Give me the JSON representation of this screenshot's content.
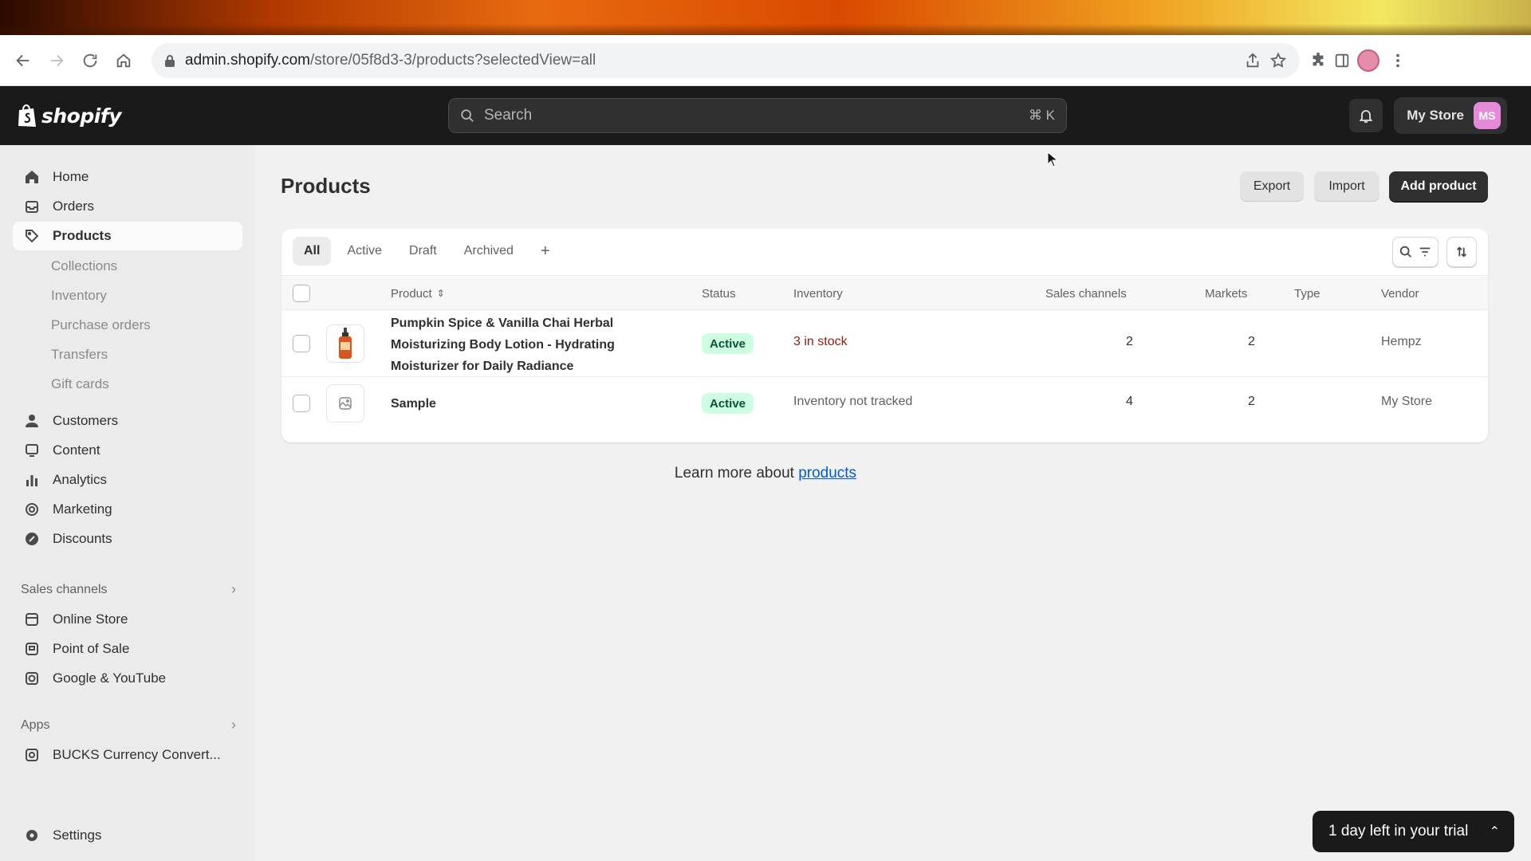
{
  "browser": {
    "url_host": "admin.shopify.com",
    "url_path": "/store/05f8d3-3/products?selectedView=all"
  },
  "topbar": {
    "logo_text": "shopify",
    "search_placeholder": "Search",
    "search_shortcut": "⌘ K",
    "store_name": "My Store",
    "store_initials": "MS"
  },
  "sidebar": {
    "main_items": [
      {
        "label": "Home",
        "icon": "home-icon"
      },
      {
        "label": "Orders",
        "icon": "orders-icon"
      },
      {
        "label": "Products",
        "icon": "tag-icon",
        "active": true
      }
    ],
    "product_subitems": [
      "Collections",
      "Inventory",
      "Purchase orders",
      "Transfers",
      "Gift cards"
    ],
    "more_items": [
      {
        "label": "Customers",
        "icon": "person-icon"
      },
      {
        "label": "Content",
        "icon": "content-icon"
      },
      {
        "label": "Analytics",
        "icon": "bar-chart-icon"
      },
      {
        "label": "Marketing",
        "icon": "target-icon"
      },
      {
        "label": "Discounts",
        "icon": "discount-icon"
      }
    ],
    "sales_channels_label": "Sales channels",
    "sales_channels": [
      {
        "label": "Online Store",
        "icon": "store-icon"
      },
      {
        "label": "Point of Sale",
        "icon": "pos-icon"
      },
      {
        "label": "Google & YouTube",
        "icon": "google-icon"
      }
    ],
    "apps_label": "Apps",
    "apps": [
      {
        "label": "BUCKS Currency Convert...",
        "icon": "currency-icon"
      }
    ],
    "settings_label": "Settings"
  },
  "page": {
    "title": "Products",
    "export_label": "Export",
    "import_label": "Import",
    "add_product_label": "Add product"
  },
  "tabs": [
    "All",
    "Active",
    "Draft",
    "Archived",
    "+"
  ],
  "table": {
    "columns": {
      "product": "Product",
      "status": "Status",
      "inventory": "Inventory",
      "sales_channels": "Sales channels",
      "markets": "Markets",
      "type": "Type",
      "vendor": "Vendor"
    },
    "rows": [
      {
        "name_line1": "Pumpkin Spice & Vanilla Chai Herbal",
        "name_line2": "Moisturizing Body Lotion - Hydrating",
        "name_line3": "Moisturizer for Daily Radiance",
        "status": "Active",
        "inventory": "3 in stock",
        "sales_channels": "2",
        "markets": "2",
        "type": "",
        "vendor": "Hempz"
      },
      {
        "name": "Sample",
        "status": "Active",
        "inventory": "Inventory not tracked",
        "sales_channels": "4",
        "markets": "2",
        "type": "",
        "vendor": "My Store"
      }
    ]
  },
  "footer": {
    "learn_prefix": "Learn more about ",
    "learn_link": "products"
  },
  "trial_banner": "1 day left in your trial",
  "colors": {
    "topbar_bg": "#1a1a1a",
    "active_badge_bg": "#cdfee1",
    "active_badge_text": "#0c5132",
    "low_stock_text": "#8e1f0b",
    "link": "#005bd3"
  }
}
